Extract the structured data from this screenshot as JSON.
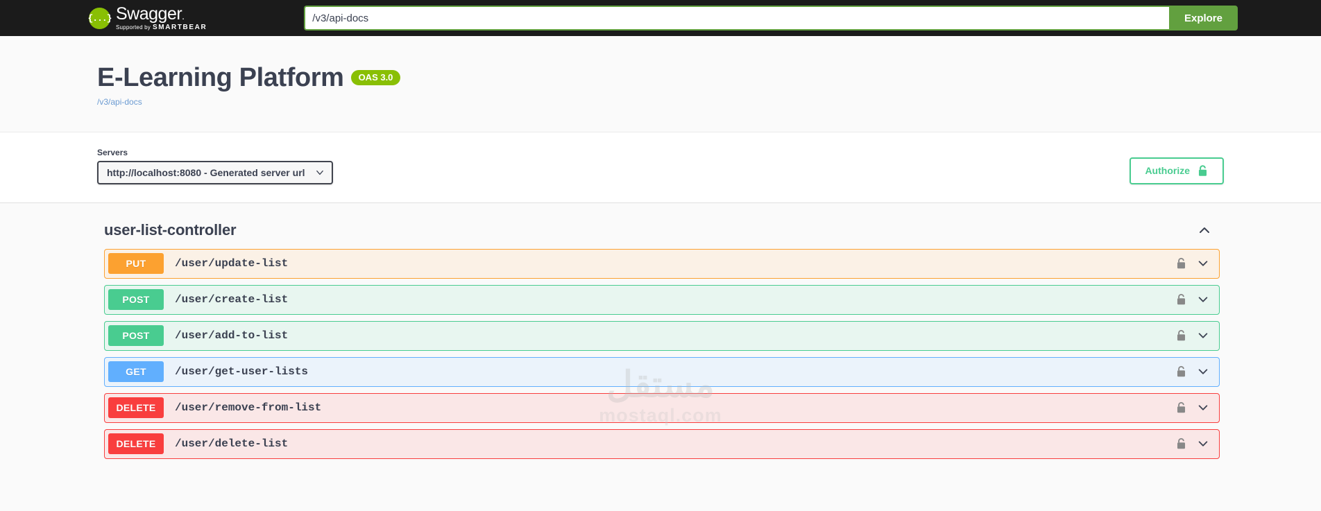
{
  "topbar": {
    "logo_text": "Swagger",
    "logo_mark": "{...}",
    "logo_supported_prefix": "Supported by",
    "logo_brand": "SMARTBEAR",
    "url_value": "/v3/api-docs",
    "url_placeholder": "",
    "explore_label": "Explore"
  },
  "info": {
    "title": "E-Learning Platform",
    "oas_badge": "OAS 3.0",
    "docs_link": "/v3/api-docs"
  },
  "servers": {
    "label": "Servers",
    "selected": "http://localhost:8080 - Generated server url",
    "options": [
      "http://localhost:8080 - Generated server url"
    ],
    "authorize_label": "Authorize",
    "authorize_icon": "unlock-icon"
  },
  "tags": [
    {
      "name": "user-list-controller",
      "collapse_icon": "chevron-up-icon",
      "operations": [
        {
          "method": "PUT",
          "method_class": "put",
          "path": "/user/update-list",
          "lock_icon": "unlock-icon",
          "expand_icon": "chevron-down-icon"
        },
        {
          "method": "POST",
          "method_class": "post",
          "path": "/user/create-list",
          "lock_icon": "unlock-icon",
          "expand_icon": "chevron-down-icon"
        },
        {
          "method": "POST",
          "method_class": "post",
          "path": "/user/add-to-list",
          "lock_icon": "unlock-icon",
          "expand_icon": "chevron-down-icon"
        },
        {
          "method": "GET",
          "method_class": "get",
          "path": "/user/get-user-lists",
          "lock_icon": "unlock-icon",
          "expand_icon": "chevron-down-icon"
        },
        {
          "method": "DELETE",
          "method_class": "delete",
          "path": "/user/remove-from-list",
          "lock_icon": "unlock-icon",
          "expand_icon": "chevron-down-icon"
        },
        {
          "method": "DELETE",
          "method_class": "delete",
          "path": "/user/delete-list",
          "lock_icon": "unlock-icon",
          "expand_icon": "chevron-down-icon"
        }
      ]
    }
  ],
  "watermark": {
    "arabic": "مستقل",
    "latin": "mostaql.com"
  },
  "colors": {
    "topbar_bg": "#1b1b1b",
    "explore_green": "#62a03f",
    "oas_green": "#89bf04",
    "authorize_green": "#49cc90",
    "put_orange": "#fca130",
    "post_green": "#49cc90",
    "get_blue": "#61affe",
    "delete_red": "#f93e3e",
    "text_dark": "#3b4151"
  }
}
